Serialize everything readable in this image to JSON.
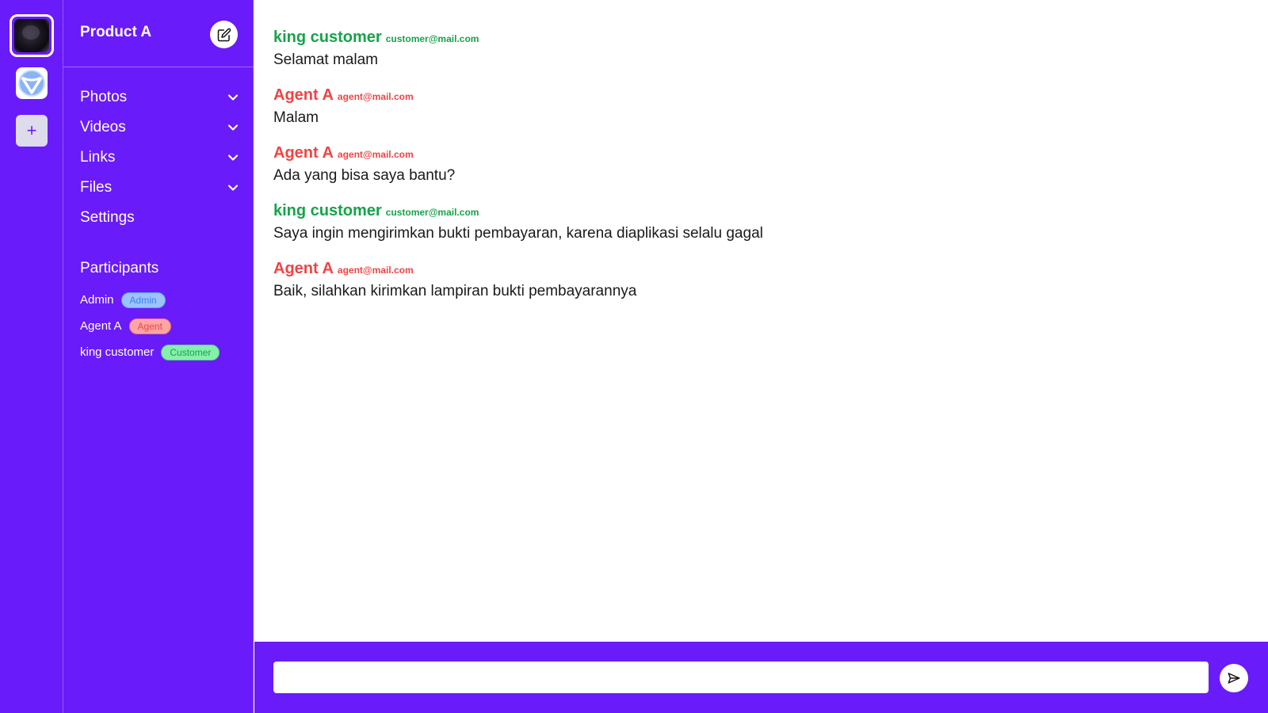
{
  "rail": {
    "items": [
      {
        "icon": "workspace-avatar-icon",
        "active": true
      },
      {
        "icon": "app-logo-icon",
        "active": false
      },
      {
        "icon": "plus-icon",
        "label": "+"
      }
    ]
  },
  "sidebar": {
    "title": "Product A",
    "edit_icon": "edit-icon",
    "menu": [
      {
        "label": "Photos",
        "icon": "chevron-down-icon"
      },
      {
        "label": "Videos",
        "icon": "chevron-down-icon"
      },
      {
        "label": "Links",
        "icon": "chevron-down-icon"
      },
      {
        "label": "Files",
        "icon": "chevron-down-icon"
      },
      {
        "label": "Settings"
      }
    ],
    "participants_title": "Participants",
    "participants": [
      {
        "name": "Admin",
        "role": "Admin",
        "role_color": "#3b82f6"
      },
      {
        "name": "Agent A",
        "role": "Agent",
        "role_color": "#ef4444"
      },
      {
        "name": "king customer",
        "role": "Customer",
        "role_color": "#16a34a"
      }
    ]
  },
  "messages": [
    {
      "name": "king customer",
      "email": "customer@mail.com",
      "text": "Selamat malam",
      "color": "#16a34a"
    },
    {
      "name": "Agent A",
      "email": "agent@mail.com",
      "text": "Malam",
      "color": "#ef4444"
    },
    {
      "name": "Agent A",
      "email": "agent@mail.com",
      "text": "Ada yang bisa saya bantu?",
      "color": "#ef4444"
    },
    {
      "name": "king customer",
      "email": "customer@mail.com",
      "text": "Saya ingin mengirimkan bukti pembayaran, karena diaplikasi selalu gagal",
      "color": "#16a34a"
    },
    {
      "name": "Agent A",
      "email": "agent@mail.com",
      "text": "Baik, silahkan kirimkan lampiran bukti pembayarannya",
      "color": "#ef4444"
    }
  ],
  "composer": {
    "value": "",
    "send_icon": "send-icon"
  },
  "colors": {
    "brand": "#6a1bf9",
    "customer": "#16a34a",
    "agent": "#ef4444",
    "admin": "#3b82f6"
  }
}
